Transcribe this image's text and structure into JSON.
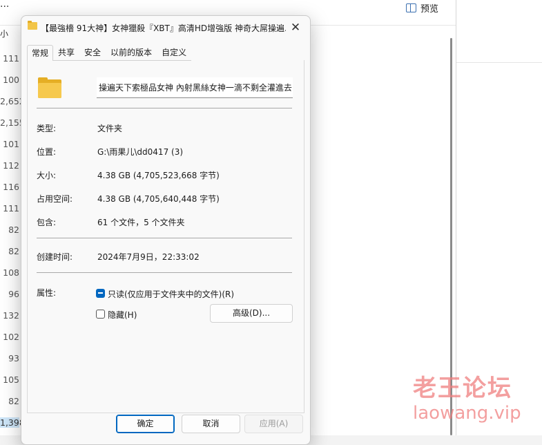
{
  "background": {
    "toolbar_dots": "···",
    "preview_label": "预览",
    "column_header": "小",
    "sizes": [
      "111",
      "100",
      "2,652",
      "2,155",
      "101",
      "112",
      "116",
      "111",
      "82",
      "82",
      "108",
      "96",
      "132",
      "102",
      "93",
      "105",
      "82",
      "1,398"
    ]
  },
  "dialog": {
    "title": "【最強檣 91大神】女神獵殺『XBT』高清HD增強版 神奇大屌操遍...",
    "close_glyph": "✕",
    "tabs": [
      "常规",
      "共享",
      "安全",
      "以前的版本",
      "自定义"
    ],
    "folder_name": "操遍天下索極品女神 內射黑絲女神一滴不剩全灌進去",
    "props": {
      "type_label": "类型:",
      "type_value": "文件夹",
      "location_label": "位置:",
      "location_value": "G:\\雨果儿\\dd0417 (3)",
      "size_label": "大小:",
      "size_value": "4.38 GB (4,705,523,668 字节)",
      "disk_label": "占用空间:",
      "disk_value": "4.38 GB (4,705,640,448 字节)",
      "contains_label": "包含:",
      "contains_value": "61 个文件，5 个文件夹",
      "created_label": "创建时间:",
      "created_value": "2024年7月9日，22:33:02",
      "attributes_label": "属性:",
      "readonly_label": "只读(仅应用于文件夹中的文件)(R)",
      "hidden_label": "隐藏(H)",
      "advanced_button": "高级(D)..."
    },
    "buttons": {
      "ok": "确定",
      "cancel": "取消",
      "apply": "应用(A)"
    }
  },
  "watermark": {
    "cn": "老王论坛",
    "en": "laowang.vip"
  },
  "colors": {
    "accent": "#0067c0",
    "folder": "#f6c94e",
    "watermark": "#f08080"
  }
}
